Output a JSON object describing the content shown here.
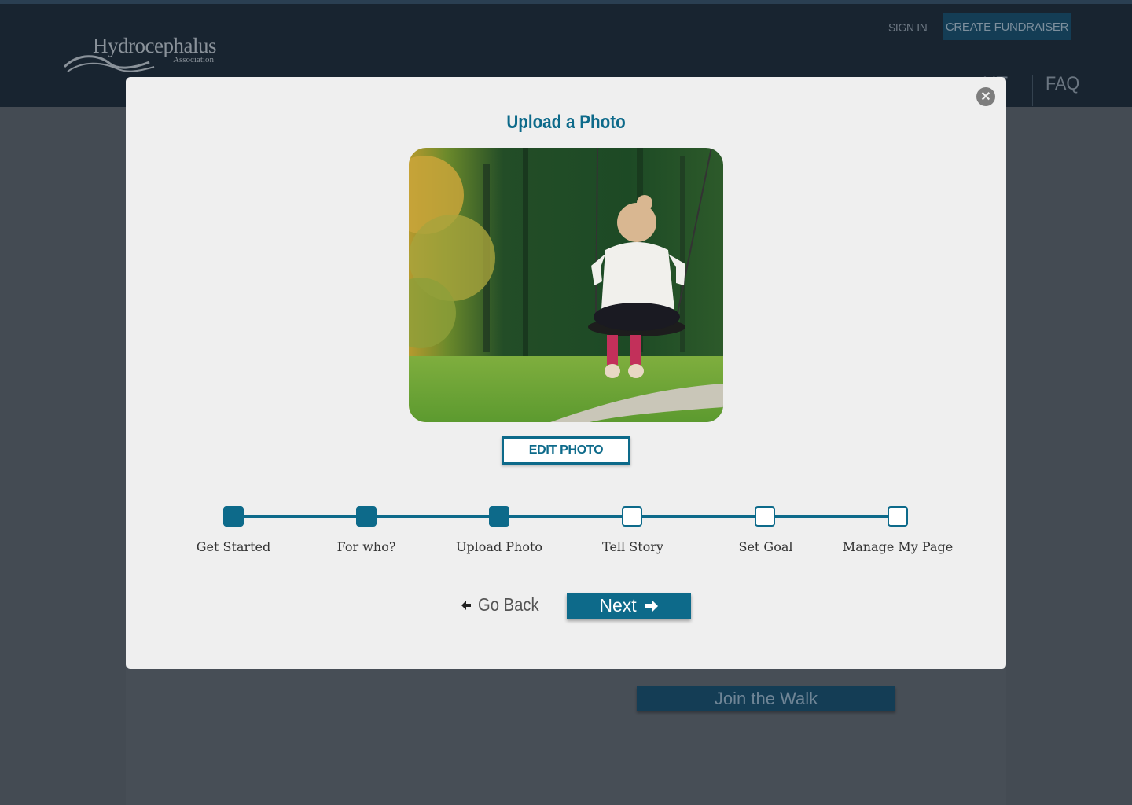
{
  "header": {
    "logo_text": "Hydrocephalus",
    "logo_sub": "Association",
    "sign_in": "SIGN IN",
    "create_fundraiser": "CREATE FUNDRAISER",
    "nav_about": "UT",
    "nav_faq": "FAQ"
  },
  "background": {
    "info_text": "",
    "join_button": "Join the Walk"
  },
  "modal": {
    "title": "Upload a Photo",
    "edit_photo": "EDIT PHOTO",
    "steps": [
      {
        "label": "Get Started",
        "done": true
      },
      {
        "label": "For who?",
        "done": true
      },
      {
        "label": "Upload Photo",
        "done": true
      },
      {
        "label": "Tell Story",
        "done": false
      },
      {
        "label": "Set Goal",
        "done": false
      },
      {
        "label": "Manage My Page",
        "done": false
      }
    ],
    "go_back": "Go Back",
    "next": "Next"
  },
  "colors": {
    "accent": "#0d6a8a",
    "modal_bg": "#efefef",
    "overlay": "#444b53"
  },
  "icons": {
    "close": "close-circle-icon",
    "back": "arrow-left-icon",
    "next": "arrow-right-icon"
  }
}
